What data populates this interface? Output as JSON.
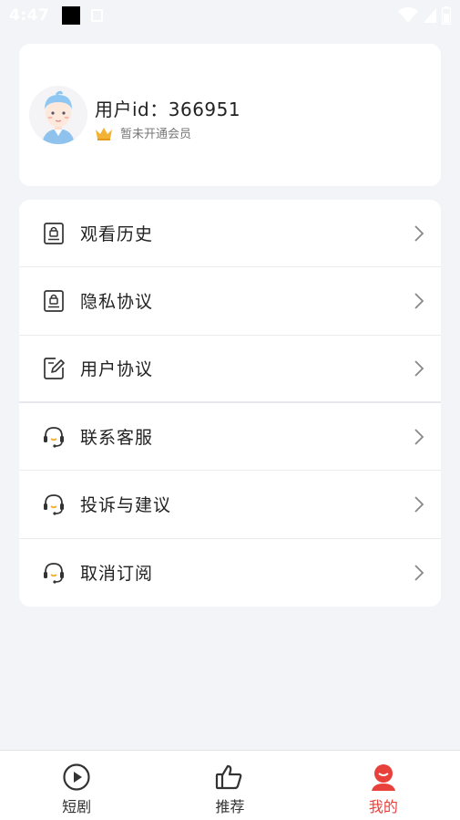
{
  "status_bar": {
    "time": "4:47"
  },
  "profile": {
    "user_id": "用户id：366951",
    "vip_status": "暂未开通会员"
  },
  "menu": [
    {
      "label": "观看历史",
      "icon": "lock-document-icon"
    },
    {
      "label": "隐私协议",
      "icon": "lock-document-icon"
    },
    {
      "label": "用户协议",
      "icon": "edit-document-icon"
    },
    {
      "label": "联系客服",
      "icon": "headset-icon"
    },
    {
      "label": "投诉与建议",
      "icon": "headset-icon"
    },
    {
      "label": "取消订阅",
      "icon": "headset-icon"
    }
  ],
  "nav": {
    "tabs": [
      {
        "label": "短剧",
        "icon": "play-icon"
      },
      {
        "label": "推荐",
        "icon": "thumbs-up-icon"
      },
      {
        "label": "我的",
        "icon": "user-face-icon"
      }
    ],
    "active": "我的"
  },
  "colors": {
    "background": "#f3f4f8",
    "accent": "#e8403b",
    "crown": "#f2b233"
  }
}
